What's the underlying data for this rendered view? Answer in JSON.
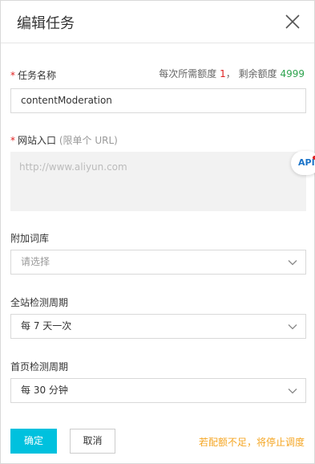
{
  "header": {
    "title": "编辑任务"
  },
  "task_name": {
    "required_mark": "*",
    "label": "任务名称",
    "quota_prefix": "每次所需额度",
    "quota_needed": "1",
    "quota_sep": "，",
    "remaining_prefix": "剩余额度",
    "remaining": "4999",
    "value": "contentModeration"
  },
  "site_entry": {
    "required_mark": "*",
    "label": "网站入口",
    "hint": "(限单个 URL)",
    "placeholder": "http://www.aliyun.com",
    "api_badge": "API"
  },
  "dictionary": {
    "label": "附加词库",
    "placeholder": "请选择"
  },
  "site_cycle": {
    "label": "全站检测周期",
    "value": "每 7 天一次"
  },
  "home_cycle": {
    "label": "首页检测周期",
    "value": "每 30 分钟"
  },
  "footer": {
    "confirm_label": "确定",
    "cancel_label": "取消",
    "warning": "若配额不足，将停止调度"
  },
  "colors": {
    "primary": "#00c1de",
    "required": "#e02020",
    "remaining": "#2ea44f",
    "warning": "#f5a623"
  }
}
